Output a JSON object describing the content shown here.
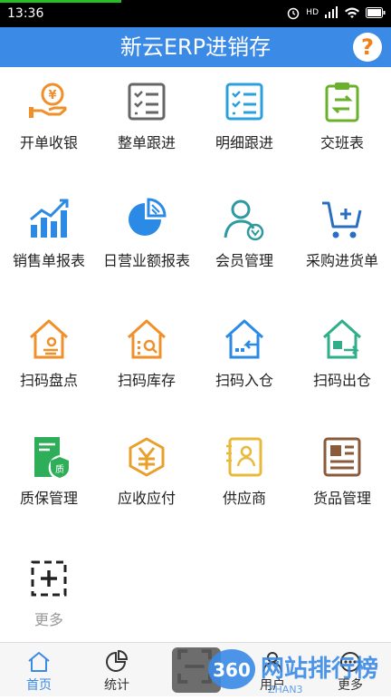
{
  "status": {
    "time": "13:36",
    "battery_icon": "battery-icon",
    "signal": "HD"
  },
  "header": {
    "title": "新云ERP进销存",
    "help_glyph": "?"
  },
  "colors": {
    "accent": "#3a8ae6",
    "orange": "#f0902a",
    "green": "#2fae5a",
    "teal": "#2e9aa0",
    "brown": "#8a5a3a",
    "gray": "#666666",
    "yellow": "#e8b93a"
  },
  "tiles": [
    {
      "label": "开单收银",
      "icon": "cashier-hand-coin-icon"
    },
    {
      "label": "整单跟进",
      "icon": "checklist-icon"
    },
    {
      "label": "明细跟进",
      "icon": "detail-checklist-icon"
    },
    {
      "label": "交班表",
      "icon": "shift-clipboard-icon"
    },
    {
      "label": "销售单报表",
      "icon": "bar-chart-icon"
    },
    {
      "label": "日营业额报表",
      "icon": "pie-chart-icon"
    },
    {
      "label": "会员管理",
      "icon": "member-icon"
    },
    {
      "label": "采购进货单",
      "icon": "cart-add-icon"
    },
    {
      "label": "扫码盘点",
      "icon": "house-scan-count-icon"
    },
    {
      "label": "扫码库存",
      "icon": "house-search-icon"
    },
    {
      "label": "扫码入仓",
      "icon": "house-in-icon"
    },
    {
      "label": "扫码出仓",
      "icon": "house-out-icon"
    },
    {
      "label": "质保管理",
      "icon": "warranty-doc-icon"
    },
    {
      "label": "应收应付",
      "icon": "yuan-box-icon"
    },
    {
      "label": "供应商",
      "icon": "supplier-card-icon"
    },
    {
      "label": "货品管理",
      "icon": "goods-card-icon"
    },
    {
      "label": "更多",
      "icon": "add-more-icon"
    }
  ],
  "nav": [
    {
      "label": "首页",
      "icon": "home-icon",
      "active": true
    },
    {
      "label": "统计",
      "icon": "stats-pie-icon",
      "active": false
    },
    {
      "label": "",
      "icon": "scan-icon",
      "active": false
    },
    {
      "label": "用户",
      "icon": "user-icon",
      "active": false
    },
    {
      "label": "更多",
      "icon": "more-icon",
      "active": false
    }
  ],
  "watermark": {
    "text": "网站排行榜",
    "badge": "360",
    "sub": "ZHAN3"
  }
}
